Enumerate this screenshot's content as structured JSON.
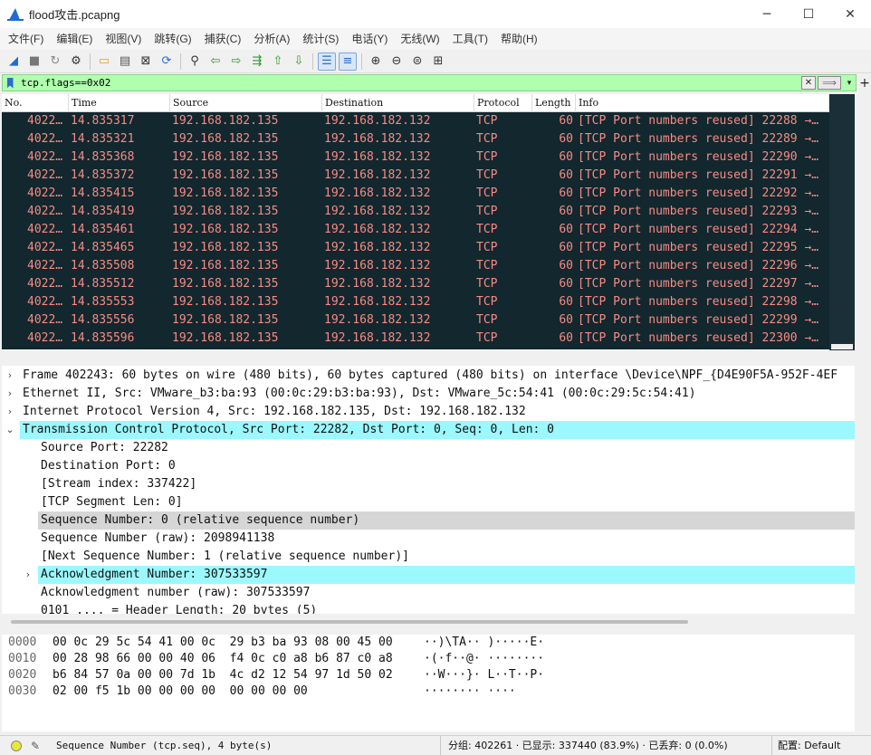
{
  "window": {
    "title": "flood攻击.pcapng",
    "minimize": "─",
    "maximize": "☐",
    "close": "✕"
  },
  "menu": [
    "文件(F)",
    "编辑(E)",
    "视图(V)",
    "跳转(G)",
    "捕获(C)",
    "分析(A)",
    "统计(S)",
    "电话(Y)",
    "无线(W)",
    "工具(T)",
    "帮助(H)"
  ],
  "toolbar_icons": [
    "shark-fin-start-icon",
    "stop-icon",
    "restart-icon",
    "options-gear-icon",
    "open-folder-icon",
    "save-file-icon",
    "close-file-icon",
    "reload-icon",
    "find-icon",
    "back-arrow-icon",
    "forward-arrow-icon",
    "goto-packet-icon",
    "first-packet-icon",
    "last-packet-icon",
    "autoscroll-icon",
    "colorize-icon",
    "zoom-in-icon",
    "zoom-out-icon",
    "zoom-normal-icon",
    "resize-columns-icon"
  ],
  "filter": {
    "value": "tcp.flags==0x02",
    "clear": "✕",
    "apply": "⟹",
    "dropdown": "▾",
    "add": "+"
  },
  "columns": [
    "No.",
    "Time",
    "Source",
    "Destination",
    "Protocol",
    "Length",
    "Info"
  ],
  "packets": [
    {
      "no": "4022…",
      "time": "14.835317",
      "src": "192.168.182.135",
      "dst": "192.168.182.132",
      "proto": "TCP",
      "len": "60",
      "info": "[TCP Port numbers reused] 22288 →…"
    },
    {
      "no": "4022…",
      "time": "14.835321",
      "src": "192.168.182.135",
      "dst": "192.168.182.132",
      "proto": "TCP",
      "len": "60",
      "info": "[TCP Port numbers reused] 22289 →…"
    },
    {
      "no": "4022…",
      "time": "14.835368",
      "src": "192.168.182.135",
      "dst": "192.168.182.132",
      "proto": "TCP",
      "len": "60",
      "info": "[TCP Port numbers reused] 22290 →…"
    },
    {
      "no": "4022…",
      "time": "14.835372",
      "src": "192.168.182.135",
      "dst": "192.168.182.132",
      "proto": "TCP",
      "len": "60",
      "info": "[TCP Port numbers reused] 22291 →…"
    },
    {
      "no": "4022…",
      "time": "14.835415",
      "src": "192.168.182.135",
      "dst": "192.168.182.132",
      "proto": "TCP",
      "len": "60",
      "info": "[TCP Port numbers reused] 22292 →…"
    },
    {
      "no": "4022…",
      "time": "14.835419",
      "src": "192.168.182.135",
      "dst": "192.168.182.132",
      "proto": "TCP",
      "len": "60",
      "info": "[TCP Port numbers reused] 22293 →…"
    },
    {
      "no": "4022…",
      "time": "14.835461",
      "src": "192.168.182.135",
      "dst": "192.168.182.132",
      "proto": "TCP",
      "len": "60",
      "info": "[TCP Port numbers reused] 22294 →…"
    },
    {
      "no": "4022…",
      "time": "14.835465",
      "src": "192.168.182.135",
      "dst": "192.168.182.132",
      "proto": "TCP",
      "len": "60",
      "info": "[TCP Port numbers reused] 22295 →…"
    },
    {
      "no": "4022…",
      "time": "14.835508",
      "src": "192.168.182.135",
      "dst": "192.168.182.132",
      "proto": "TCP",
      "len": "60",
      "info": "[TCP Port numbers reused] 22296 →…"
    },
    {
      "no": "4022…",
      "time": "14.835512",
      "src": "192.168.182.135",
      "dst": "192.168.182.132",
      "proto": "TCP",
      "len": "60",
      "info": "[TCP Port numbers reused] 22297 →…"
    },
    {
      "no": "4022…",
      "time": "14.835553",
      "src": "192.168.182.135",
      "dst": "192.168.182.132",
      "proto": "TCP",
      "len": "60",
      "info": "[TCP Port numbers reused] 22298 →…"
    },
    {
      "no": "4022…",
      "time": "14.835556",
      "src": "192.168.182.135",
      "dst": "192.168.182.132",
      "proto": "TCP",
      "len": "60",
      "info": "[TCP Port numbers reused] 22299 →…"
    },
    {
      "no": "4022…",
      "time": "14.835596",
      "src": "192.168.182.135",
      "dst": "192.168.182.132",
      "proto": "TCP",
      "len": "60",
      "info": "[TCP Port numbers reused] 22300 →…"
    }
  ],
  "details": [
    {
      "level": 0,
      "arrow": "›",
      "text": "Frame 402243: 60 bytes on wire (480 bits), 60 bytes captured (480 bits) on interface \\Device\\NPF_{D4E90F5A-952F-4EF",
      "hl": ""
    },
    {
      "level": 0,
      "arrow": "›",
      "text": "Ethernet II, Src: VMware_b3:ba:93 (00:0c:29:b3:ba:93), Dst: VMware_5c:54:41 (00:0c:29:5c:54:41)",
      "hl": ""
    },
    {
      "level": 0,
      "arrow": "›",
      "text": "Internet Protocol Version 4, Src: 192.168.182.135, Dst: 192.168.182.132",
      "hl": ""
    },
    {
      "level": 0,
      "arrow": "⌄",
      "text": "Transmission Control Protocol, Src Port: 22282, Dst Port: 0, Seq: 0, Len: 0",
      "hl": "cyan"
    },
    {
      "level": 1,
      "arrow": "",
      "text": "Source Port: 22282",
      "hl": ""
    },
    {
      "level": 1,
      "arrow": "",
      "text": "Destination Port: 0",
      "hl": ""
    },
    {
      "level": 1,
      "arrow": "",
      "text": "[Stream index: 337422]",
      "hl": ""
    },
    {
      "level": 1,
      "arrow": "",
      "text": "[TCP Segment Len: 0]",
      "hl": ""
    },
    {
      "level": 1,
      "arrow": "",
      "text": "Sequence Number: 0    (relative sequence number)",
      "hl": "gray"
    },
    {
      "level": 1,
      "arrow": "",
      "text": "Sequence Number (raw): 2098941138",
      "hl": ""
    },
    {
      "level": 1,
      "arrow": "",
      "text": "[Next Sequence Number: 1    (relative sequence number)]",
      "hl": ""
    },
    {
      "level": 1,
      "arrow": "›",
      "text": "Acknowledgment Number: 307533597",
      "hl": "cyan"
    },
    {
      "level": 1,
      "arrow": "",
      "text": "Acknowledgment number (raw): 307533597",
      "hl": ""
    },
    {
      "level": 1,
      "arrow": "",
      "text": "0101 .... = Header Length: 20 bytes (5)",
      "hl": ""
    }
  ],
  "bytes": [
    {
      "offset": "0000",
      "hex": "00 0c 29 5c 54 41 00 0c  29 b3 ba 93 08 00 45 00",
      "ascii": "··)\\TA·· )·····E·"
    },
    {
      "offset": "0010",
      "hex": "00 28 98 66 00 00 40 06  f4 0c c0 a8 b6 87 c0 a8",
      "ascii": "·(·f··@· ········"
    },
    {
      "offset": "0020",
      "hex": "b6 84 57 0a 00 00 7d 1b  4c d2 12 54 97 1d 50 02",
      "ascii": "··W···}· L··T··P·"
    },
    {
      "offset": "0030",
      "hex": "02 00 f5 1b 00 00 00 00  00 00 00 00",
      "ascii": "········ ····"
    }
  ],
  "status": {
    "field": "Sequence Number (tcp.seq), 4 byte(s)",
    "stats": "分组: 402261 · 已显示: 337440 (83.9%) · 已丢弃: 0 (0.0%)",
    "profile": "配置: Default"
  }
}
